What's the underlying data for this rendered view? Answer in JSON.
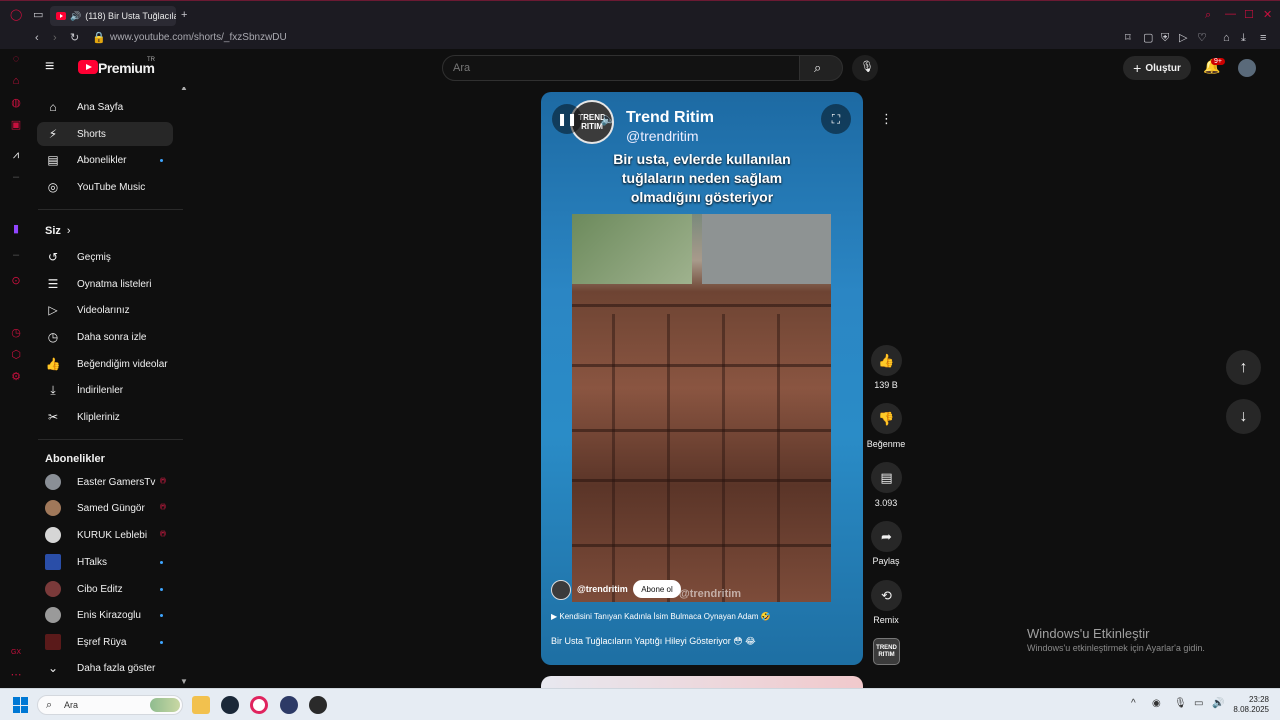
{
  "browser": {
    "tab_title": "(118) Bir Usta Tuğlacıla",
    "url": "www.youtube.com/shorts/_fxzSbnzwDU"
  },
  "header": {
    "logo_text": "Premium",
    "logo_region": "TR",
    "search_placeholder": "Ara",
    "create_label": "Oluştur",
    "notification_count": "9+"
  },
  "nav": {
    "main": [
      {
        "label": "Ana Sayfa",
        "icon": "home-icon"
      },
      {
        "label": "Shorts",
        "icon": "shorts-icon",
        "active": true
      },
      {
        "label": "Abonelikler",
        "icon": "subscriptions-icon"
      },
      {
        "label": "YouTube Music",
        "icon": "music-icon"
      }
    ],
    "you_heading": "Siz",
    "you_items": [
      {
        "label": "Geçmiş",
        "icon": "history-icon"
      },
      {
        "label": "Oynatma listeleri",
        "icon": "playlist-icon"
      },
      {
        "label": "Videolarınız",
        "icon": "your-videos-icon"
      },
      {
        "label": "Daha sonra izle",
        "icon": "watch-later-icon"
      },
      {
        "label": "Beğendiğim videolar",
        "icon": "liked-icon"
      },
      {
        "label": "İndirilenler",
        "icon": "download-icon"
      },
      {
        "label": "Klipleriniz",
        "icon": "scissors-icon"
      }
    ],
    "subs_heading": "Abonelikler",
    "subscriptions": [
      {
        "label": "Easter GamersTv",
        "status": "live"
      },
      {
        "label": "Samed Güngör",
        "status": "live"
      },
      {
        "label": "KURUK Leblebi",
        "status": "live"
      },
      {
        "label": "HTalks",
        "status": "new"
      },
      {
        "label": "Cibo Editz",
        "status": "new"
      },
      {
        "label": "Enis Kirazoglu",
        "status": "new"
      },
      {
        "label": "Eşref Rüya",
        "status": "new"
      }
    ],
    "show_more": "Daha fazla göster"
  },
  "short": {
    "channel_name": "Trend Ritim",
    "channel_handle": "@trendritim",
    "avatar_text": "TREND RITIM",
    "caption": "Bir usta, evlerde kullanılan tuğlaların neden sağlam olmadığını gösteriyor",
    "watermark": "@trendritim",
    "bottom_handle": "@trendritim",
    "subscribe_label": "Abone ol",
    "next_video": "Kendisini Tanıyan Kadınla İsim Bulmaca Oynayan Adam 🤣",
    "description": "Bir Usta Tuğlacıların Yaptığı Hileyi Gösteriyor 😳 😂"
  },
  "actions": {
    "likes": "139 B",
    "dislike_label": "Beğenme",
    "comments": "3.093",
    "share_label": "Paylaş",
    "remix_label": "Remix"
  },
  "watermark_windows": {
    "title": "Windows'u Etkinleştir",
    "subtitle": "Windows'u etkinleştirmek için Ayarlar'a gidin."
  },
  "taskbar": {
    "search_placeholder": "Ara",
    "time": "23:28",
    "date": "8.08.2025"
  }
}
